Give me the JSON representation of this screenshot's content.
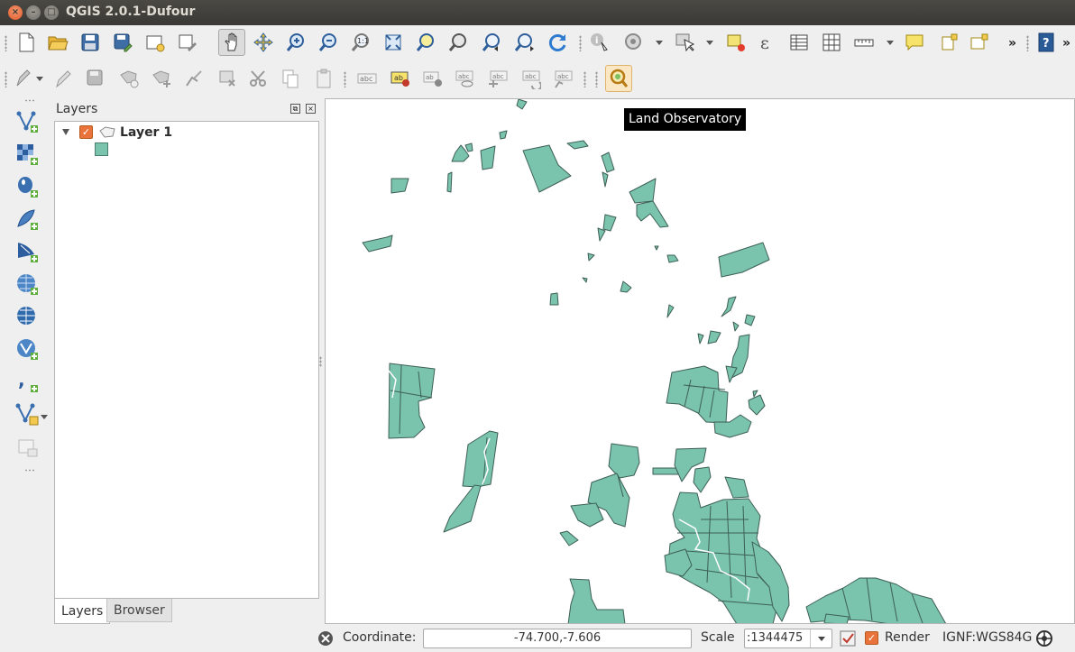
{
  "window": {
    "title": "QGIS 2.0.1-Dufour"
  },
  "toolbar_main": {
    "buttons": [
      "new-project",
      "open-project",
      "save-project",
      "save-as",
      "new-print-composer",
      "composer-manager",
      "pan",
      "pan-to-selection",
      "zoom-in",
      "zoom-out",
      "zoom-native",
      "zoom-full",
      "zoom-to-selection",
      "zoom-to-layer",
      "zoom-last",
      "zoom-next",
      "refresh",
      "identify",
      "action",
      "select",
      "deselect",
      "expression",
      "attribute-table",
      "statistics",
      "measure",
      "annotation",
      "new-bookmark",
      "show-bookmarks",
      "more",
      "help"
    ]
  },
  "toolbar_edit": {
    "buttons": [
      "digitizing",
      "toggle-editing",
      "save-edits",
      "add-feature",
      "move-feature",
      "node-tool",
      "delete-selected",
      "cut",
      "copy",
      "paste",
      "label",
      "pin-label",
      "highlight-pinned",
      "show-hide-labels",
      "move-label",
      "rotate-label",
      "change-label",
      "land-observatory"
    ]
  },
  "left_toolbar": {
    "buttons": [
      "add-vector-layer",
      "add-raster-layer",
      "add-postgis-layer",
      "add-spatialite-layer",
      "add-mssql-layer",
      "add-wms-layer",
      "add-wcs-layer",
      "add-wfs-layer",
      "add-delimited-text-layer",
      "new-shapefile-layer",
      "remove-layer"
    ]
  },
  "layers_panel": {
    "title": "Layers",
    "layers": [
      {
        "name": "Layer 1",
        "checked": true,
        "fill_color": "#7ac3ad"
      }
    ],
    "tabs": [
      "Layers",
      "Browser"
    ],
    "active_tab": "Layers"
  },
  "map": {
    "fill_color": "#7ac3ad",
    "stroke_color": "#3d5f55",
    "tooltip": "Land Observatory"
  },
  "statusbar": {
    "coordinate_label": "Coordinate:",
    "coordinate_value": "-74.700,-7.606",
    "scale_label": "Scale",
    "scale_value": ":1344475",
    "render_label": "Render",
    "render_checked": true,
    "crs": "IGNF:WGS84G"
  }
}
